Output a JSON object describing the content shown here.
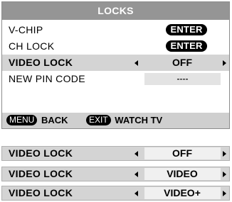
{
  "menu": {
    "title": "LOCKS",
    "rows": [
      {
        "label": "V-CHIP",
        "button": "ENTER"
      },
      {
        "label": "CH LOCK",
        "button": "ENTER"
      },
      {
        "label": "VIDEO LOCK",
        "value": "OFF"
      },
      {
        "label": "NEW PIN CODE",
        "value": "----"
      }
    ],
    "footer": {
      "menu_key": "MENU",
      "menu_action": "BACK",
      "exit_key": "EXIT",
      "exit_action": "WATCH TV"
    }
  },
  "strips": [
    {
      "label": "VIDEO LOCK",
      "value": "OFF"
    },
    {
      "label": "VIDEO LOCK",
      "value": "VIDEO"
    },
    {
      "label": "VIDEO LOCK",
      "value": "VIDEO+"
    }
  ]
}
